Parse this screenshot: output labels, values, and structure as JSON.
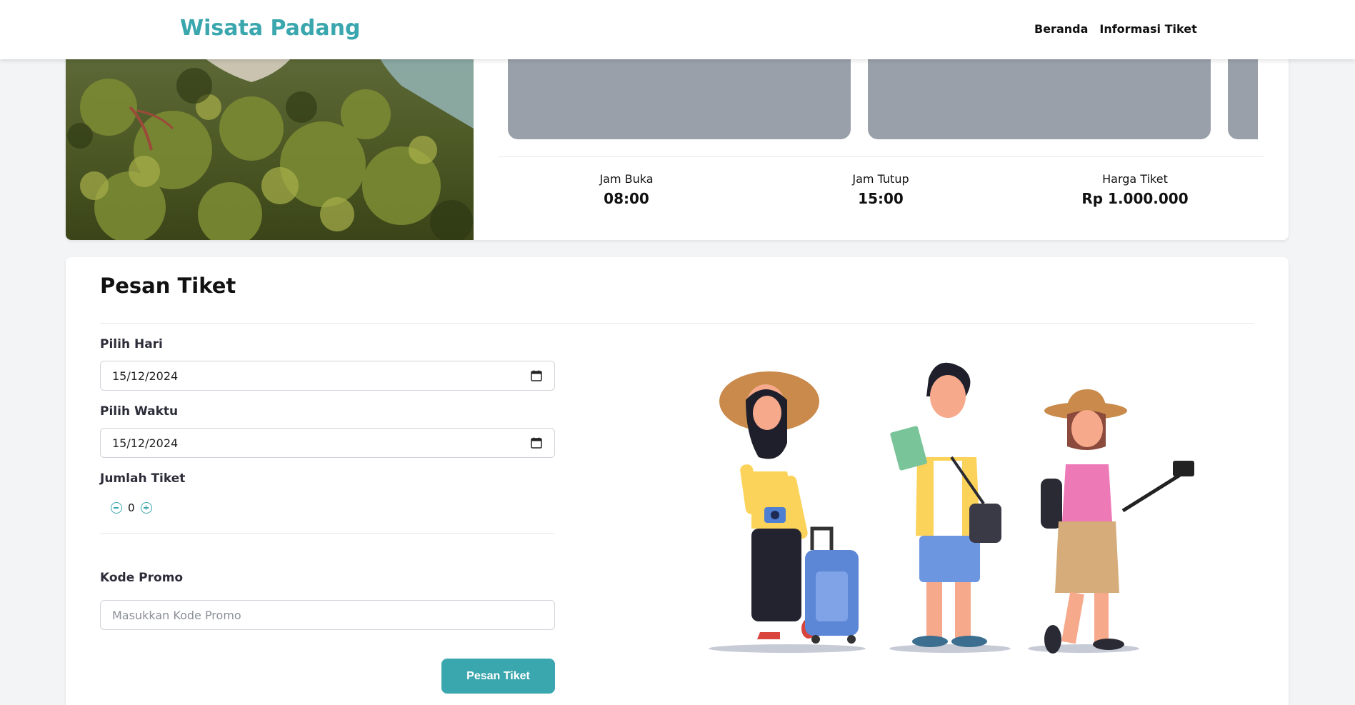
{
  "navbar": {
    "brand": "Wisata Padang",
    "links": [
      "Beranda",
      "Informasi Tiket"
    ]
  },
  "info": {
    "open_label": "Jam Buka",
    "open_value": "08:00",
    "close_label": "Jam Tutup",
    "close_value": "15:00",
    "price_label": "Harga Tiket",
    "price_value": "Rp 1.000.000"
  },
  "form": {
    "title": "Pesan Tiket",
    "day_label": "Pilih Hari",
    "day_value": "15/12/2024",
    "time_label": "Pilih Waktu",
    "time_value": "15/12/2024",
    "qty_label": "Jumlah Tiket",
    "qty_value": "0",
    "promo_label": "Kode Promo",
    "promo_placeholder": "Masukkan Kode Promo",
    "submit_label": "Pesan Tiket"
  },
  "colors": {
    "accent": "#3aa6ad",
    "placeholder_thumb": "#9aa0aa"
  },
  "icons": [
    "calendar-icon",
    "minus-circle-icon",
    "plus-circle-icon"
  ]
}
